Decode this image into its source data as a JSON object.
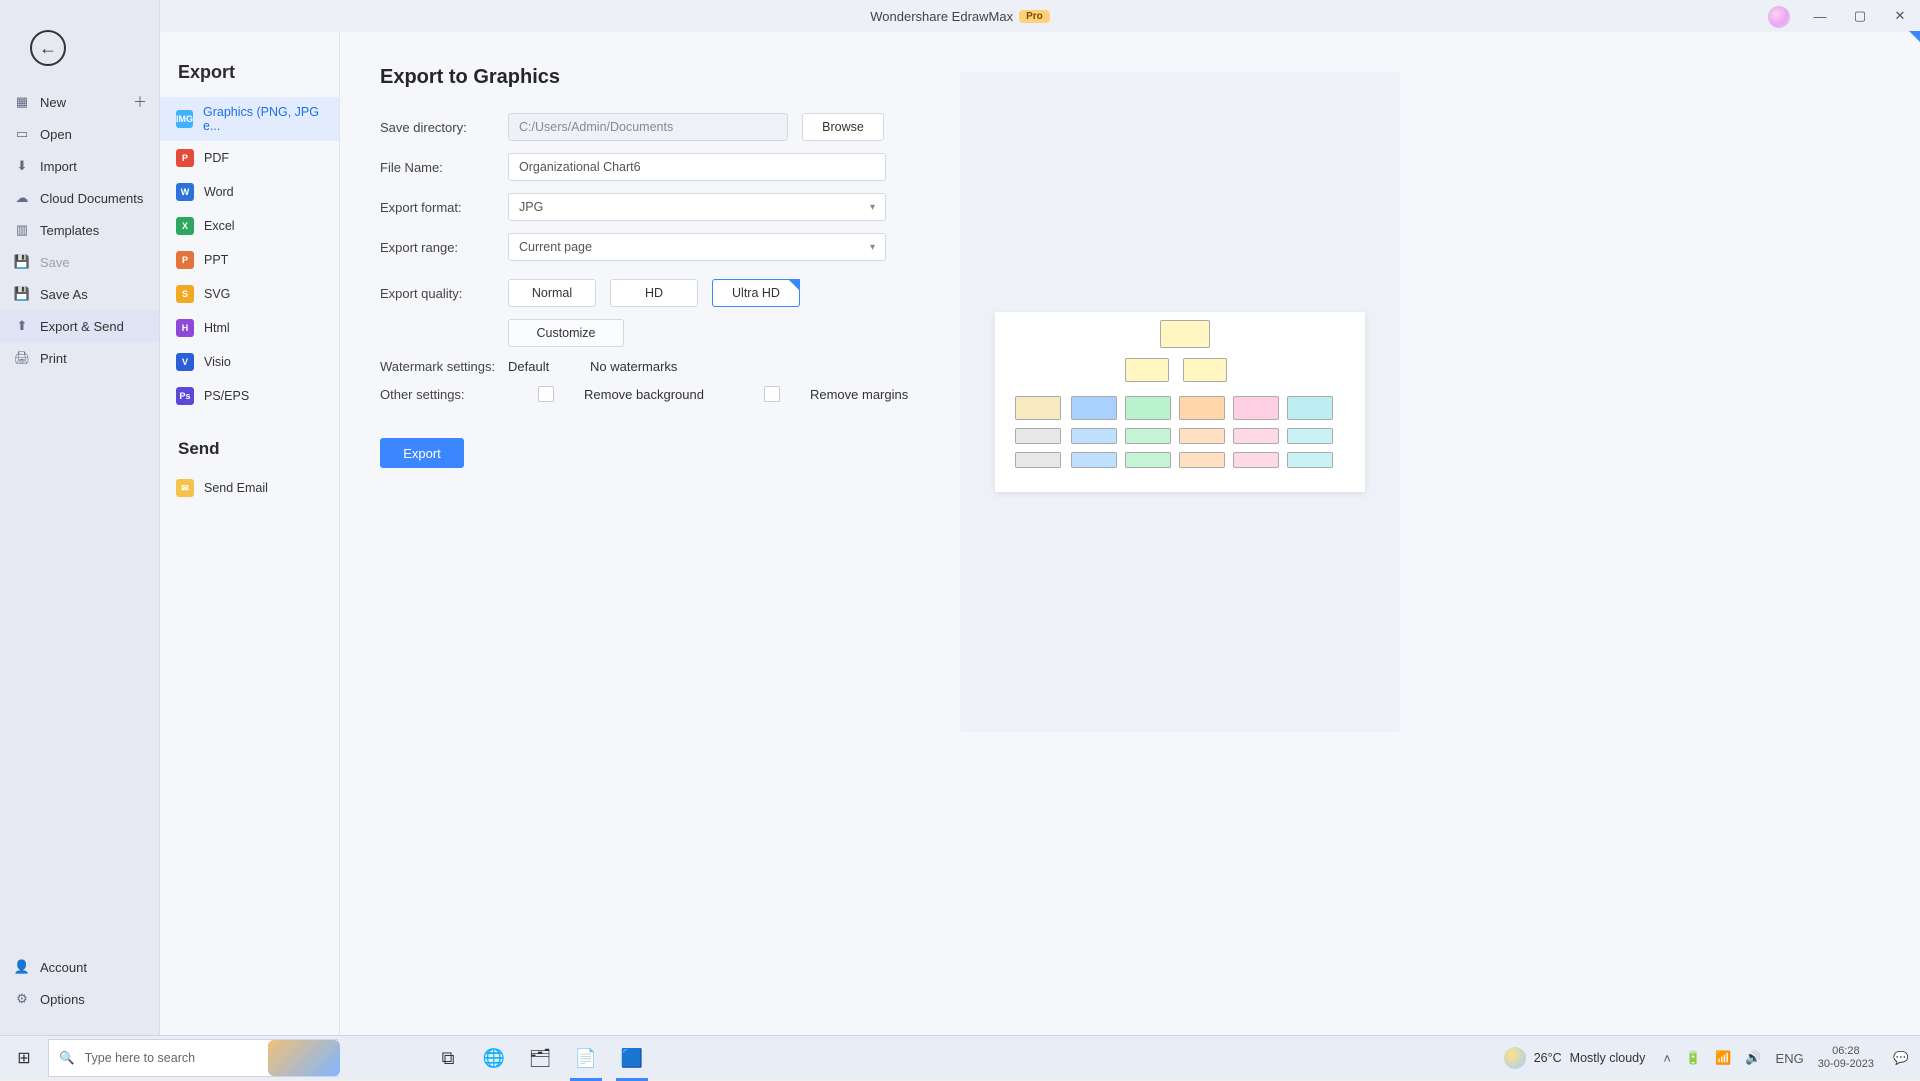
{
  "titlebar": {
    "app_name": "Wondershare EdrawMax",
    "pro_label": "Pro"
  },
  "sidebar": {
    "items": [
      {
        "label": "New"
      },
      {
        "label": "Open"
      },
      {
        "label": "Import"
      },
      {
        "label": "Cloud Documents"
      },
      {
        "label": "Templates"
      },
      {
        "label": "Save"
      },
      {
        "label": "Save As"
      },
      {
        "label": "Export & Send"
      },
      {
        "label": "Print"
      }
    ],
    "account_label": "Account",
    "options_label": "Options"
  },
  "exportcol": {
    "export_header": "Export",
    "send_header": "Send",
    "items": [
      {
        "label": "Graphics (PNG, JPG e..."
      },
      {
        "label": "PDF"
      },
      {
        "label": "Word"
      },
      {
        "label": "Excel"
      },
      {
        "label": "PPT"
      },
      {
        "label": "SVG"
      },
      {
        "label": "Html"
      },
      {
        "label": "Visio"
      },
      {
        "label": "PS/EPS"
      }
    ],
    "send_items": [
      {
        "label": "Send Email"
      }
    ]
  },
  "main": {
    "heading": "Export to Graphics",
    "labels": {
      "save_dir": "Save directory:",
      "file_name": "File Name:",
      "export_format": "Export format:",
      "export_range": "Export range:",
      "export_quality": "Export quality:",
      "watermark": "Watermark settings:",
      "other": "Other settings:"
    },
    "values": {
      "save_dir": "C:/Users/Admin/Documents",
      "browse": "Browse",
      "file_name": "Organizational Chart6",
      "export_format": "JPG",
      "export_range": "Current page",
      "quality_normal": "Normal",
      "quality_hd": "HD",
      "quality_ultra": "Ultra HD",
      "customize": "Customize",
      "wm_default": "Default",
      "wm_none": "No watermarks",
      "remove_bg": "Remove background",
      "remove_margins": "Remove margins",
      "export_btn": "Export"
    }
  },
  "taskbar": {
    "search_placeholder": "Type here to search",
    "weather_temp": "26°C",
    "weather_text": "Mostly cloudy",
    "time": "06:28",
    "date": "30-09-2023"
  }
}
